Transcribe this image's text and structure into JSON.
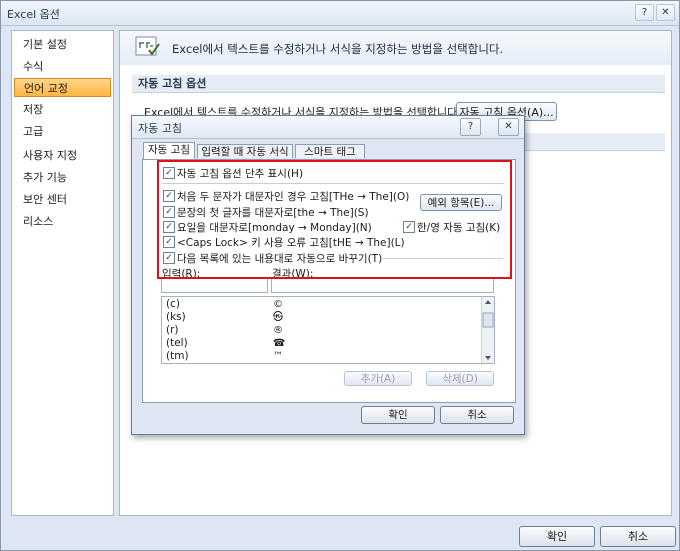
{
  "window": {
    "title": "Excel 옵션",
    "help_glyph": "?",
    "close_glyph": "✕"
  },
  "sidebar": {
    "items": [
      {
        "label": "기본 설정"
      },
      {
        "label": "수식"
      },
      {
        "label": "언어 교정",
        "active": true
      },
      {
        "label": "저장"
      },
      {
        "label": "고급"
      },
      {
        "label": "사용자 지정"
      },
      {
        "label": "추가 기능"
      },
      {
        "label": "보안 센터"
      },
      {
        "label": "리소스"
      }
    ]
  },
  "main": {
    "header": "Excel에서 텍스트를 수정하거나 서식을 지정하는 방법을 선택합니다.",
    "section_autocorrect": "자동 고침 옵션",
    "autocorrect_desc": "Excel에서 텍스트를 수정하거나 서식을 지정하는 방법을 선택합니다.",
    "autocorrect_button": "자동 고침 옵션(A)..."
  },
  "footer": {
    "ok": "확인",
    "cancel": "취소"
  },
  "dialog": {
    "title": "자동 고침",
    "help_glyph": "?",
    "close_glyph": "✕",
    "tabs": [
      {
        "label": "자동 고침",
        "active": true
      },
      {
        "label": "입력할 때 자동 서식"
      },
      {
        "label": "스마트 태그"
      }
    ],
    "options": {
      "show_buttons": {
        "label": "자동 고침 옵션 단추 표시(H)",
        "checked": true
      },
      "two_initial_caps": {
        "label": "처음 두 문자가 대문자인 경우 고침[THe → The](O)",
        "checked": true
      },
      "capitalize_first": {
        "label": "문장의 첫 글자를 대문자로[the → The](S)",
        "checked": true
      },
      "capitalize_days": {
        "label": "요일을 대문자로[monday → Monday](N)",
        "checked": true
      },
      "caps_lock": {
        "label": "<Caps Lock> 키 사용 오류 고침[tHE → The](L)",
        "checked": true
      },
      "korean_english": {
        "label": "한/영 자동 고침(K)",
        "checked": true
      },
      "replace_text": {
        "label": "다음 목록에 있는 내용대로 자동으로 바꾸기(T)",
        "checked": true
      }
    },
    "check_glyph": "✓",
    "exceptions_button": "예외 항목(E)...",
    "replace_label": "입력(R):",
    "with_label": "결과(W):",
    "replace_value": "",
    "with_value": "",
    "list": [
      {
        "input": "(c)",
        "result": "©"
      },
      {
        "input": "(ks)",
        "result": "㉿"
      },
      {
        "input": "(r)",
        "result": "®"
      },
      {
        "input": "(tel)",
        "result": "☎"
      },
      {
        "input": "(tm)",
        "result": "™"
      }
    ],
    "add_button": "추가(A)",
    "delete_button": "삭제(D)",
    "ok": "확인",
    "cancel": "취소"
  }
}
